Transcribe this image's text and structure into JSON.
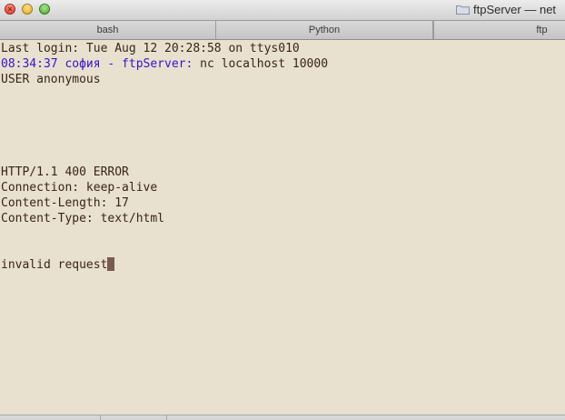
{
  "window": {
    "title": "ftpServer — net"
  },
  "tabs": [
    {
      "label": "bash"
    },
    {
      "label": "Python"
    },
    {
      "label": "ftp"
    }
  ],
  "terminal": {
    "lines": [
      "Last login: Tue Aug 12 20:28:58 on ttys010",
      "",
      "USER anonymous",
      "",
      "",
      "",
      "",
      "",
      "HTTP/1.1 400 ERROR",
      "Connection: keep-alive",
      "Content-Length: 17",
      "Content-Type: text/html",
      "",
      "",
      "invalid request"
    ],
    "prompt": "08:34:37 софия - ftpServer:",
    "command": " nc localhost 10000",
    "colors": {
      "background": "#e8e1cf",
      "text": "#3a2418",
      "prompt": "#3a12c8",
      "cursor": "#7a5a52"
    }
  }
}
